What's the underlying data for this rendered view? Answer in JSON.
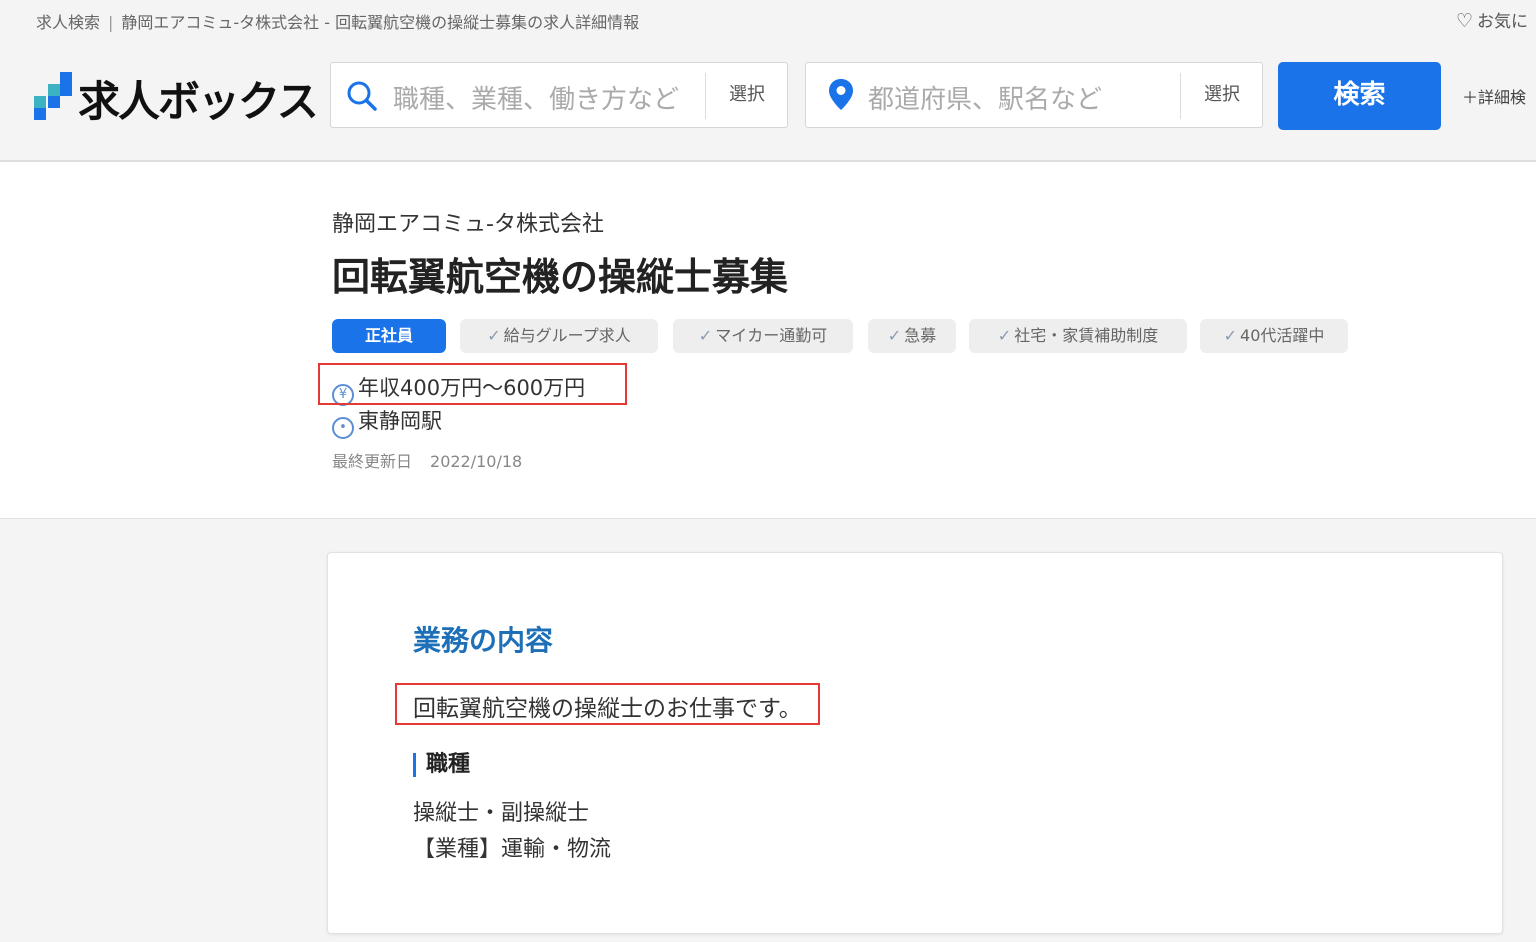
{
  "breadcrumb": {
    "home": "求人検索",
    "current": "静岡エアコミュ-タ株式会社 - 回転翼航空機の操縦士募集の求人詳細情報"
  },
  "favorites_label": "お気に",
  "logo": {
    "text": "求人ボックス"
  },
  "search": {
    "job_placeholder": "職種、業種、働き方など",
    "job_select": "選択",
    "location_placeholder": "都道府県、駅名など",
    "location_select": "選択",
    "button": "検索",
    "detail_link": "＋詳細検"
  },
  "job": {
    "company": "静岡エアコミュ-タ株式会社",
    "title": "回転翼航空機の操縦士募集",
    "tags": [
      {
        "label": "正社員",
        "primary": true
      },
      {
        "label": "給与グループ求人"
      },
      {
        "label": "マイカー通勤可"
      },
      {
        "label": "急募"
      },
      {
        "label": "社宅・家賃補助制度"
      },
      {
        "label": "40代活躍中"
      }
    ],
    "salary": "年収400万円～600万円",
    "location": "東静岡駅",
    "updated_label": "最終更新日",
    "updated_date": "2022/10/18"
  },
  "details": {
    "section_title": "業務の内容",
    "description": "回転翼航空機の操縦士のお仕事です。",
    "category_title": "職種",
    "category_lines": [
      "操縦士・副操縦士",
      "【業種】運輸・物流"
    ]
  },
  "colors": {
    "accent": "#1a73e8",
    "highlight_border": "#e53935",
    "section_title": "#1d6fb8"
  }
}
